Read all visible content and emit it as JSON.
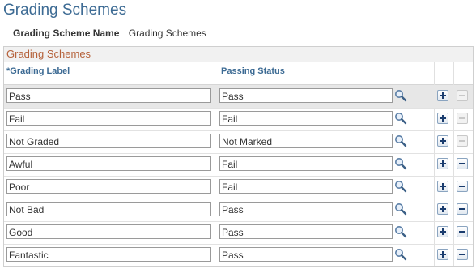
{
  "page": {
    "title": "Grading Schemes"
  },
  "field": {
    "label": "Grading Scheme Name",
    "value": "Grading Schemes"
  },
  "grid": {
    "title": "Grading Schemes",
    "columns": {
      "label": "*Grading Label",
      "status": "Passing Status"
    },
    "rows": [
      {
        "label": "Pass",
        "status": "Pass",
        "delete_enabled": false,
        "selected": true
      },
      {
        "label": "Fail",
        "status": "Fail",
        "delete_enabled": false
      },
      {
        "label": "Not Graded",
        "status": "Not Marked",
        "delete_enabled": false
      },
      {
        "label": "Awful",
        "status": "Fail",
        "delete_enabled": true
      },
      {
        "label": "Poor",
        "status": "Fail",
        "delete_enabled": true
      },
      {
        "label": "Not Bad",
        "status": "Pass",
        "delete_enabled": true
      },
      {
        "label": "Good",
        "status": "Pass",
        "delete_enabled": true
      },
      {
        "label": "Fantastic",
        "status": "Pass",
        "delete_enabled": true
      }
    ]
  },
  "icons": {
    "lookup": "magnifier-icon",
    "add": "plus-icon",
    "delete": "minus-icon"
  },
  "colors": {
    "title": "#3d6b94",
    "grid_title": "#b5613a",
    "button_glyph": "#1a3c6e"
  }
}
